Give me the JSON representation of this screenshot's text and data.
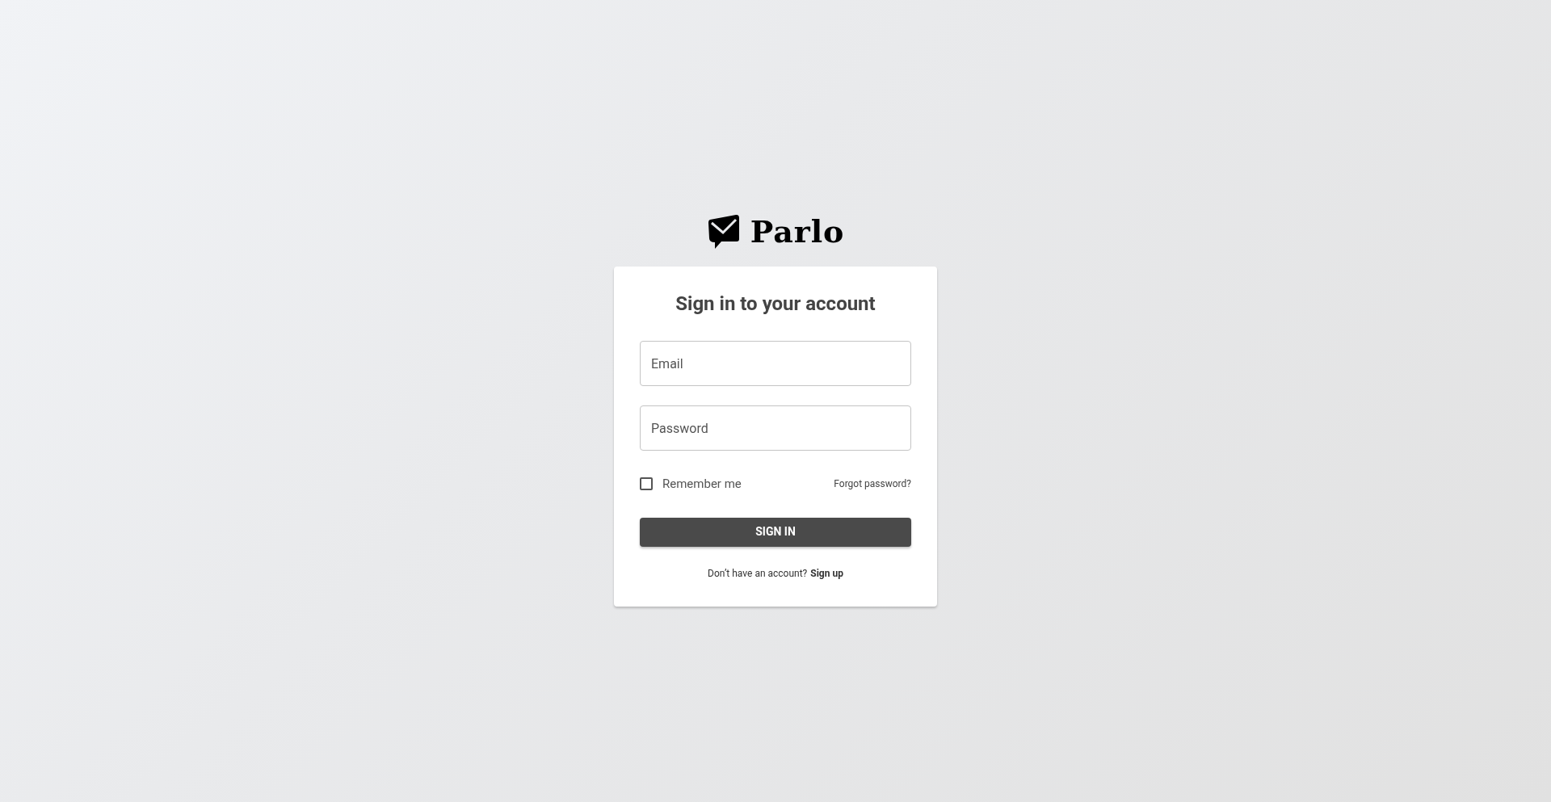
{
  "logo": {
    "text": "Parlo"
  },
  "card": {
    "title": "Sign in to your account",
    "fields": [
      {
        "placeholder": "Email"
      },
      {
        "placeholder": "Password"
      }
    ],
    "remember": {
      "label": "Remember me",
      "checked": false
    },
    "forgot_link": "Forgot password?",
    "submit_button": "SIGN IN",
    "footer": {
      "text": "Don’t have an account?",
      "link": "Sign up"
    }
  }
}
